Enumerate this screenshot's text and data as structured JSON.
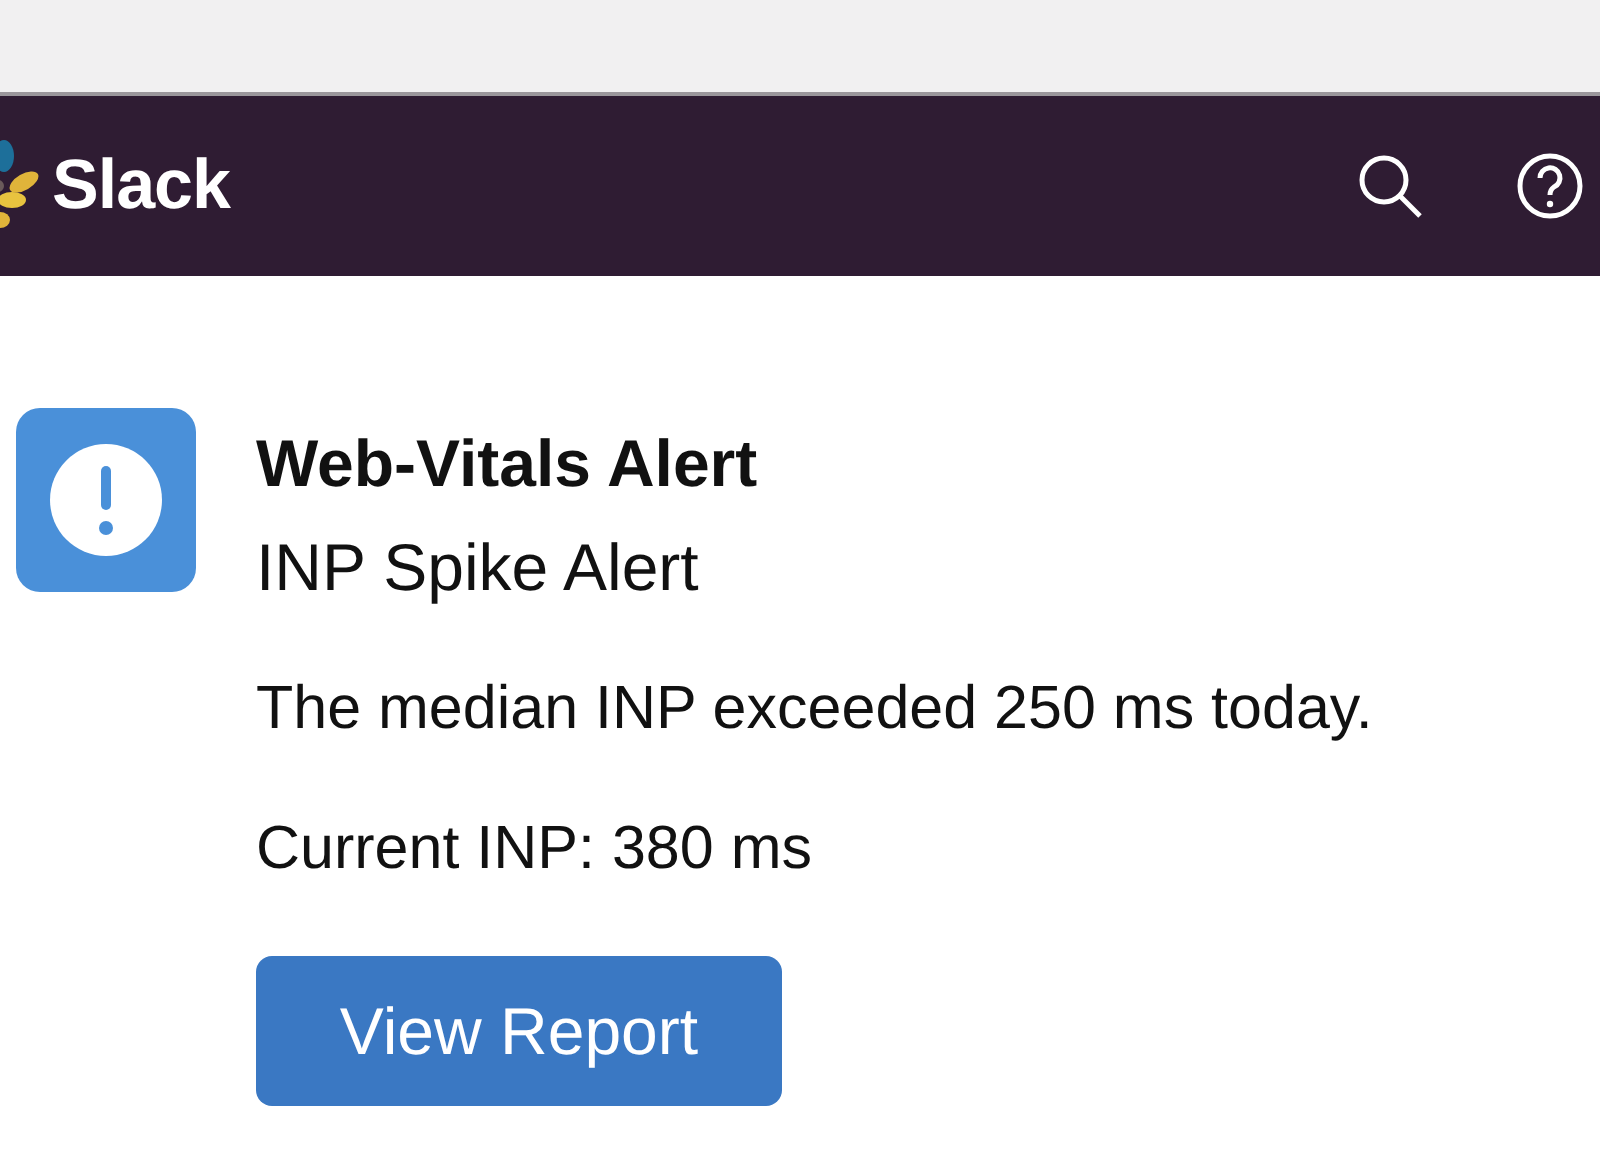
{
  "header": {
    "logo_text": "Slack"
  },
  "message": {
    "title": "Web-Vitals Alert",
    "subtitle": "INP Spike Alert",
    "body": "The median INP exceeded 250 ms today.",
    "metric": "Current INP: 380 ms",
    "button": "View Report"
  }
}
